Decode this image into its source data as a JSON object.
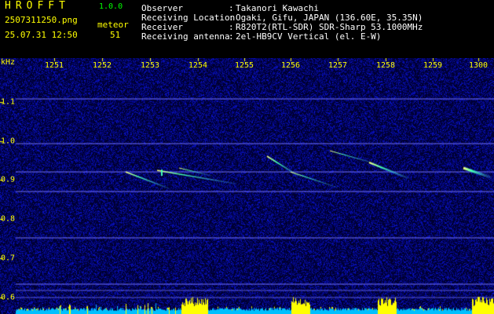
{
  "header": {
    "logo": "HROFFT",
    "version": "1.0.0",
    "filename": "2507311250.png",
    "timestamp": "25.07.31 12:50",
    "type_label": "meteor",
    "count": "51",
    "info": [
      {
        "label": "Observer",
        "value": "Takanori Kawachi"
      },
      {
        "label": "Receiving Location",
        "value": "Ogaki, Gifu, JAPAN (136.60E, 35.35N)"
      },
      {
        "label": "Receiver",
        "value": "R820T2(RTL-SDR) SDR-Sharp 53.1000MHz"
      },
      {
        "label": "Receiving antenna",
        "value": "2el-HB9CV Vertical (el. E-W)"
      }
    ],
    "separator": ":"
  },
  "axes": {
    "y_unit": "kHz",
    "x_ticks": [
      "1251",
      "1252",
      "1253",
      "1254",
      "1255",
      "1256",
      "1257",
      "1258",
      "1259",
      "1300"
    ],
    "y_ticks": [
      "1.1",
      "1.0",
      "0.9",
      "0.8",
      "0.7",
      "0.6"
    ]
  },
  "colors": {
    "background": "#000030",
    "line": "#7070ff",
    "meteor": "#40ffb0",
    "meteor_core": "#ffff80",
    "label": "#ffff00",
    "bar_low": "#00c0ff",
    "bar_high": "#ffff00"
  }
}
